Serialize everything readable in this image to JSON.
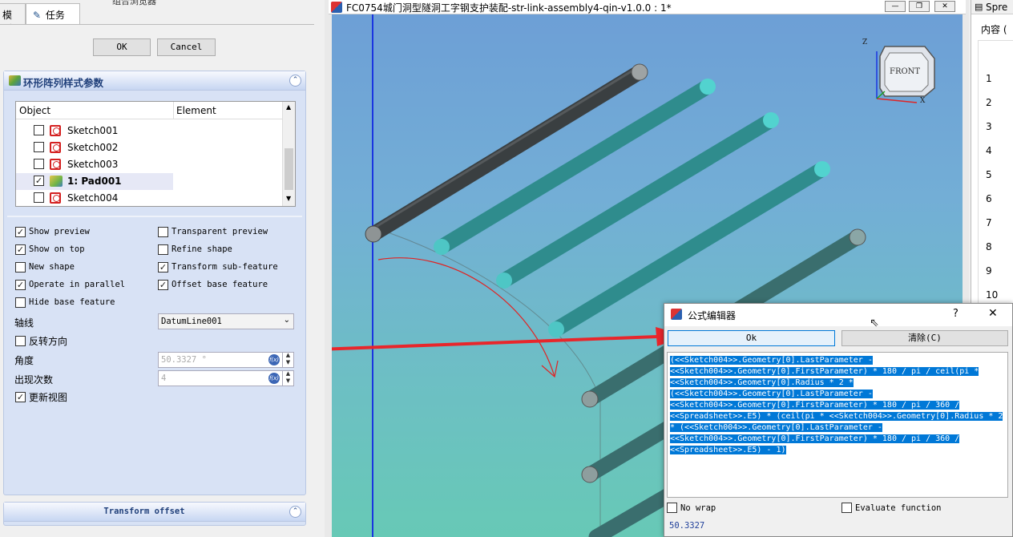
{
  "left_panel": {
    "top_title": "组合浏览器",
    "tabs": [
      "模型",
      "任务"
    ],
    "ok_label": "OK",
    "cancel_label": "Cancel",
    "polar_panel": {
      "title": "环形阵列样式参数",
      "columns": [
        "Object",
        "Element"
      ],
      "items": [
        {
          "label": "Sketch001",
          "checked": false,
          "type": "sketch"
        },
        {
          "label": "Sketch002",
          "checked": false,
          "type": "sketch"
        },
        {
          "label": "Sketch003",
          "checked": false,
          "type": "sketch"
        },
        {
          "label": "1: Pad001",
          "checked": true,
          "type": "pad"
        },
        {
          "label": "Sketch004",
          "checked": false,
          "type": "sketch"
        }
      ],
      "options_left": [
        {
          "label": "Show preview",
          "checked": true
        },
        {
          "label": "Show on top",
          "checked": true
        },
        {
          "label": "New shape",
          "checked": false
        },
        {
          "label": "Operate in parallel",
          "checked": true
        },
        {
          "label": "Hide base feature",
          "checked": false
        }
      ],
      "options_right": [
        {
          "label": "Transparent preview",
          "checked": false
        },
        {
          "label": "Refine shape",
          "checked": false
        },
        {
          "label": "Transform sub-feature",
          "checked": true
        },
        {
          "label": "Offset base feature",
          "checked": true
        }
      ],
      "axis_label": "轴线",
      "axis_value": "DatumLine001",
      "reverse_label": "反转方向",
      "reverse_checked": false,
      "angle_label": "角度",
      "angle_value": "50.3327 °",
      "occurrences_label": "出现次数",
      "occurrences_value": "4",
      "update_label": "更新视图",
      "update_checked": true
    },
    "offset_panel": {
      "title": "Transform offset"
    }
  },
  "view": {
    "title": "FC0754城门洞型隧洞工字钢支护装配-str-link-assembly4-qin-v1.0.0 : 1*",
    "navcube_face": "FRONT",
    "axes": [
      "Z",
      "X"
    ]
  },
  "spreadsheet": {
    "tab_label": "Spre",
    "content_label": "内容 (",
    "rows": [
      "1",
      "2",
      "3",
      "4",
      "5",
      "6",
      "7",
      "8",
      "9",
      "10"
    ]
  },
  "expression_editor": {
    "title": "公式编辑器",
    "help_label": "?",
    "close_label": "✕",
    "ok_label": "Ok",
    "clear_label": "清除(C)",
    "expression_lines": [
      "(<<Sketch004>>.Geometry[0].LastParameter -",
      "<<Sketch004>>.Geometry[0].FirstParameter) * 180 / pi / ceil(pi *",
      "<<Sketch004>>.Geometry[0].Radius * 2 *",
      "(<<Sketch004>>.Geometry[0].LastParameter -",
      "<<Sketch004>>.Geometry[0].FirstParameter) * 180 / pi / 360 /",
      "<<Spreadsheet>>.E5) * (ceil(pi * <<Sketch004>>.Geometry[0].Radius * 2",
      "* (<<Sketch004>>.Geometry[0].LastParameter -",
      "<<Sketch004>>.Geometry[0].FirstParameter) * 180 / pi / 360 /",
      "<<Spreadsheet>>.E5) - 1)"
    ],
    "no_wrap_label": "No wrap",
    "evaluate_label": "Evaluate function",
    "result": "50.3327"
  },
  "colors": {
    "selection": "#0078d7",
    "arrow": "#e8262b",
    "datum_line": "#1a35e0",
    "rod_teal": "#3aa7a6",
    "rod_dark": "#444a4c"
  }
}
